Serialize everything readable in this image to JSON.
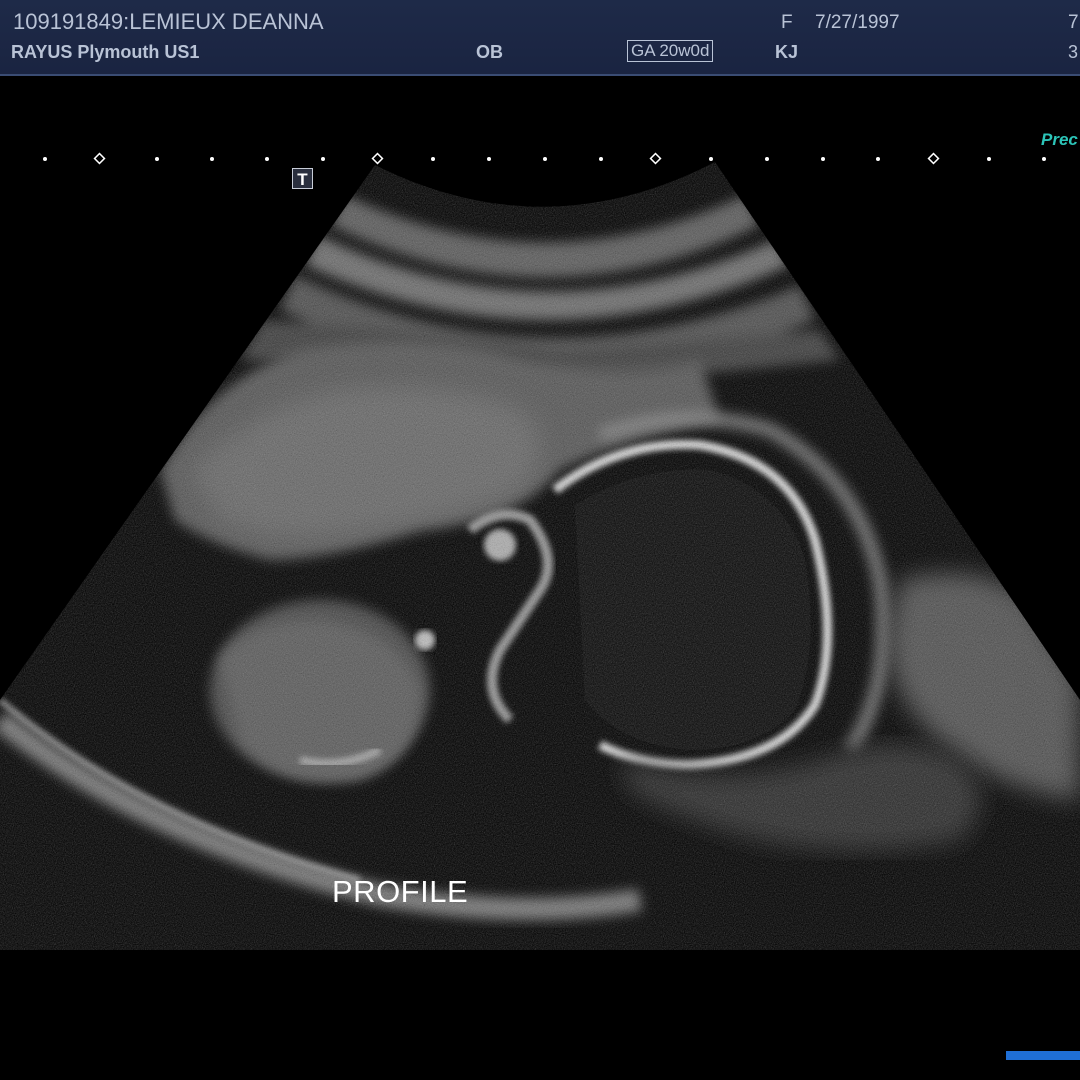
{
  "header": {
    "patient_id_name": "109191849:LEMIEUX DEANNA",
    "sex": "F",
    "dob": "7/27/1997",
    "edge_top": "7",
    "site": "RAYUS Plymouth US1",
    "exam": "OB",
    "gestational_age": "GA 20w0d",
    "operator": "KJ",
    "edge_bottom": "3"
  },
  "overlay": {
    "preset_label": "Prec",
    "t_marker": "T",
    "annotation": "PROFILE"
  },
  "colors": {
    "header_bg": "#1e2a48",
    "header_text": "#b9c3d6",
    "preset_text": "#2cc4b8",
    "bar": "#1f6fd6"
  }
}
